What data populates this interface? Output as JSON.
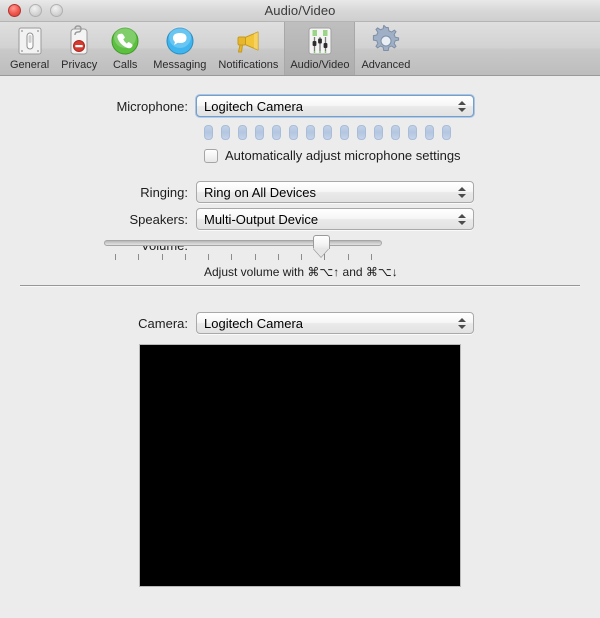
{
  "window": {
    "title": "Audio/Video",
    "traffic_lights": [
      {
        "name": "close",
        "state": "active"
      },
      {
        "name": "minimize",
        "state": "disabled"
      },
      {
        "name": "zoom",
        "state": "disabled"
      }
    ]
  },
  "toolbar": {
    "items": [
      {
        "label": "General",
        "icon": "light-switch-icon",
        "selected": false
      },
      {
        "label": "Privacy",
        "icon": "do-not-disturb-icon",
        "selected": false
      },
      {
        "label": "Calls",
        "icon": "phone-icon",
        "selected": false
      },
      {
        "label": "Messaging",
        "icon": "speech-bubble-icon",
        "selected": false
      },
      {
        "label": "Notifications",
        "icon": "megaphone-icon",
        "selected": false
      },
      {
        "label": "Audio/Video",
        "icon": "audio-mixer-icon",
        "selected": true
      },
      {
        "label": "Advanced",
        "icon": "gear-icon",
        "selected": false
      }
    ]
  },
  "audio": {
    "microphone": {
      "label": "Microphone:",
      "value": "Logitech Camera",
      "focused": true,
      "options": [
        "Logitech Camera"
      ]
    },
    "level_meter": {
      "segments": 15,
      "active_segments": 0,
      "inactive_color": "#b3c6e0"
    },
    "auto_adjust": {
      "label": "Automatically adjust microphone settings",
      "checked": false
    },
    "ringing": {
      "label": "Ringing:",
      "value": "Ring on All Devices",
      "options": [
        "Ring on All Devices"
      ]
    },
    "speakers": {
      "label": "Speakers:",
      "value": "Multi-Output Device",
      "options": [
        "Multi-Output Device"
      ]
    },
    "volume": {
      "label": "Volume:",
      "percent": 78,
      "ticks": 12,
      "hint": "Adjust volume with ⌘⌥↑ and ⌘⌥↓"
    }
  },
  "video": {
    "camera": {
      "label": "Camera:",
      "value": "Logitech Camera",
      "options": [
        "Logitech Camera"
      ]
    },
    "preview": {
      "name": "camera-preview",
      "background": "#000000"
    }
  }
}
